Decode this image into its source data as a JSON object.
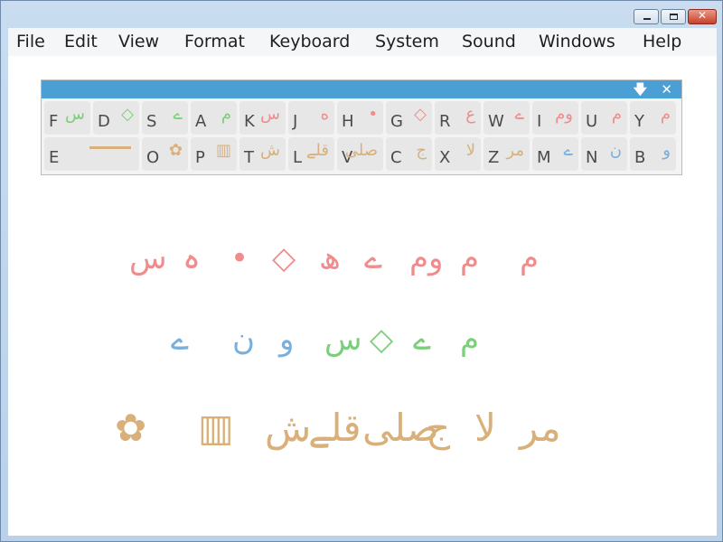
{
  "window": {
    "buttons": {
      "minimize": "–",
      "maximize": "□",
      "close": "✕"
    }
  },
  "menu": [
    "File",
    "Edit",
    "View",
    "Format",
    "Keyboard",
    "System",
    "Sound",
    "Windows",
    "Help"
  ],
  "keyboard": {
    "header_buttons": {
      "collapse": "🡇",
      "close": "✕"
    },
    "row1": [
      {
        "letter": "F",
        "glyph": "س",
        "color": "green"
      },
      {
        "letter": "D",
        "glyph": "◇",
        "color": "green"
      },
      {
        "letter": "S",
        "glyph": "ے",
        "color": "green"
      },
      {
        "letter": "A",
        "glyph": "م",
        "color": "green"
      },
      {
        "letter": "K",
        "glyph": "س",
        "color": "pink"
      },
      {
        "letter": "J",
        "glyph": "ه",
        "color": "pink"
      },
      {
        "letter": "H",
        "glyph": "•",
        "color": "pink"
      },
      {
        "letter": "G",
        "glyph": "◇",
        "color": "pink"
      },
      {
        "letter": "R",
        "glyph": "ع",
        "color": "pink"
      },
      {
        "letter": "W",
        "glyph": "ے",
        "color": "pink"
      },
      {
        "letter": "I",
        "glyph": "وم",
        "color": "pink"
      },
      {
        "letter": "U",
        "glyph": "م",
        "color": "pink"
      },
      {
        "letter": "Y",
        "glyph": "م",
        "color": "pink"
      }
    ],
    "row2": [
      {
        "letter": "E",
        "glyph": "",
        "color": "tan"
      },
      {
        "letter": "O",
        "glyph": "✿",
        "color": "tan"
      },
      {
        "letter": "P",
        "glyph": "▥",
        "color": "tan"
      },
      {
        "letter": "T",
        "glyph": "ش",
        "color": "tan"
      },
      {
        "letter": "L",
        "glyph": "قلے",
        "color": "tan"
      },
      {
        "letter": "V",
        "glyph": "صلی",
        "color": "tan"
      },
      {
        "letter": "C",
        "glyph": "ج",
        "color": "tan"
      },
      {
        "letter": "X",
        "glyph": "لا",
        "color": "tan"
      },
      {
        "letter": "Z",
        "glyph": "مر",
        "color": "tan"
      },
      {
        "letter": "M",
        "glyph": "ے",
        "color": "blue"
      },
      {
        "letter": "N",
        "glyph": "ن",
        "color": "blue"
      },
      {
        "letter": "B",
        "glyph": "و",
        "color": "blue"
      }
    ]
  },
  "canvas": {
    "line1": [
      "س",
      "ہ",
      "•",
      "◇",
      "ھ",
      "ے",
      "وم",
      "م",
      "م"
    ],
    "line2": [
      "ے",
      "ن",
      "و",
      "س",
      "◇",
      "ے",
      "م"
    ],
    "line3": [
      "✿",
      "▥",
      "ش",
      "قلے",
      "صلی",
      "ج",
      "لا",
      "مر"
    ]
  },
  "colors": {
    "pink": "#f08c8c",
    "green": "#7ccf7a",
    "blue": "#7aafdc",
    "tan": "#d9b07a",
    "header": "#4a9fd5"
  }
}
